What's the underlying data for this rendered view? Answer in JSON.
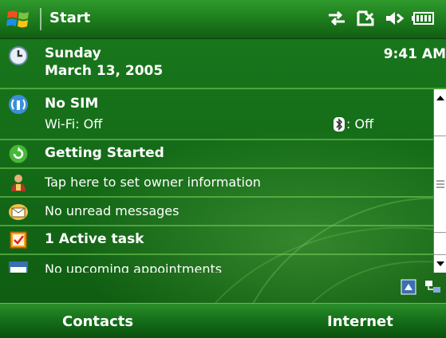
{
  "titlebar": {
    "title": "Start",
    "status_icons": [
      "connectivity-icon",
      "no-phone-icon",
      "speaker-icon",
      "battery-icon"
    ]
  },
  "today": {
    "date_day": "Sunday",
    "date_full": "March 13, 2005",
    "time": "9:41 AM",
    "phone_status": "No SIM",
    "wifi_status": "Wi-Fi: Off",
    "bluetooth_status": ": Off",
    "getting_started": "Getting Started",
    "owner_info": "Tap here to set owner information",
    "messages": "No unread messages",
    "tasks": "1 Active task",
    "appointments": "No upcoming appointments"
  },
  "softkeys": {
    "left": "Contacts",
    "right": "Internet"
  },
  "colors": {
    "background": "#157318",
    "divider": "#78d25a",
    "text": "#ffffff"
  }
}
